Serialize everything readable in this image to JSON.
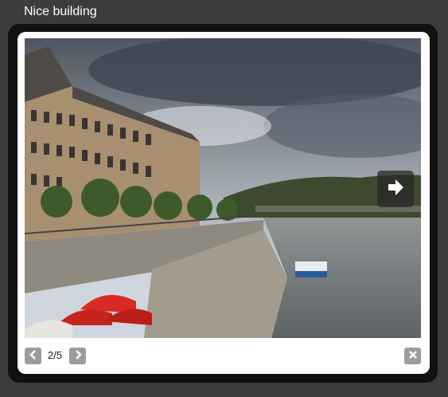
{
  "lightbox": {
    "title": "Nice building",
    "counter": "2/5",
    "controls": {
      "prev_icon": "chevron-left-icon",
      "next_icon": "chevron-right-icon",
      "close_icon": "close-icon",
      "overlay_next_icon": "arrow-right-icon"
    },
    "colors": {
      "page_background": "#3c3c3c",
      "frame": "#111111",
      "panel": "#ffffff",
      "control_button": "#9c9c9c"
    }
  }
}
